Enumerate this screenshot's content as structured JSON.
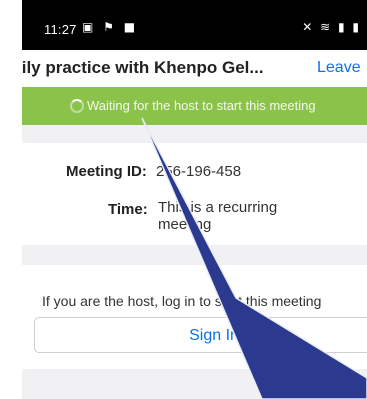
{
  "status_bar": {
    "time": "11:27",
    "left_icons": "▣ ⚑ ■",
    "right_icons": "✕ ≋ ▮ ▮"
  },
  "header": {
    "title": "Daily practice with Khenpo Gel...",
    "leave_label": "Leave"
  },
  "banner": {
    "text": "Waiting for the host to start this meeting"
  },
  "meeting": {
    "id_label": "Meeting ID:",
    "id_value": "256-196-458",
    "time_label": "Time:",
    "time_value": "This is a recurring meeting"
  },
  "host_section": {
    "prompt": "If you are the host, log in to start this meeting",
    "sign_in_label": "Sign In"
  },
  "colors": {
    "accent": "#0e71eb",
    "banner_green": "#8bc34a",
    "pointer": "#2b3a8f"
  }
}
